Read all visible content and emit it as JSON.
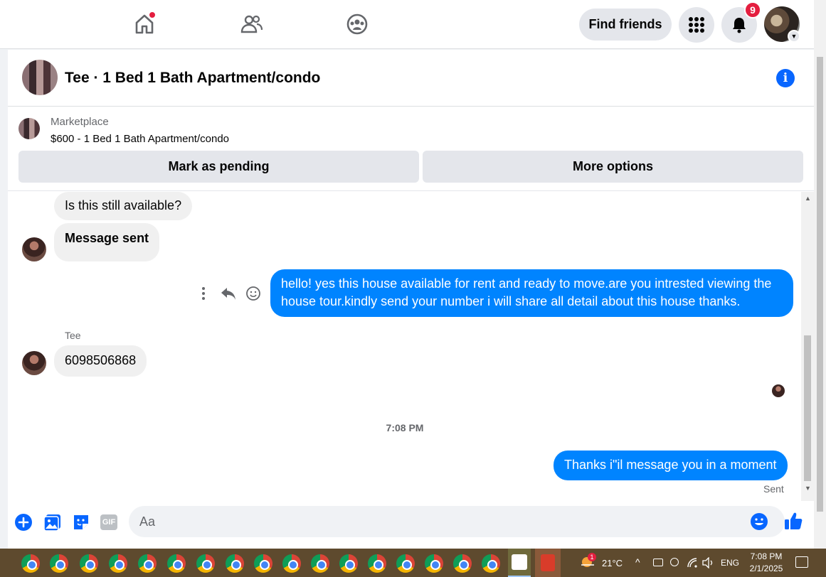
{
  "topnav": {
    "find_friends_label": "Find friends",
    "notification_count": "9"
  },
  "chat": {
    "title": "Tee · 1 Bed 1 Bath Apartment/condo",
    "marketplace_label": "Marketplace",
    "listing": "$600 - 1 Bed 1 Bath Apartment/condo",
    "mark_pending_label": "Mark as pending",
    "more_options_label": "More options"
  },
  "messages": {
    "m1": "Is this still available?",
    "m2": "Message sent",
    "m3": "hello! yes this house available for rent and ready to move.are you intrested viewing the house tour.kindly send your number i will share all detail about this house thanks.",
    "sender_name": "Tee",
    "m4": "6098506868",
    "timestamp": "7:08 PM",
    "m5": "Thanks i\"il message you in a moment",
    "status": "Sent"
  },
  "composer": {
    "placeholder": "Aa",
    "gif_label": "GIF"
  },
  "taskbar": {
    "weather": "21°C",
    "weather_badge": "1",
    "language": "ENG",
    "time": "7:08 PM",
    "date": "2/1/2025"
  },
  "colors": {
    "accent": "#0084ff",
    "brand_blue": "#0866ff",
    "notification_red": "#e41e3f"
  }
}
